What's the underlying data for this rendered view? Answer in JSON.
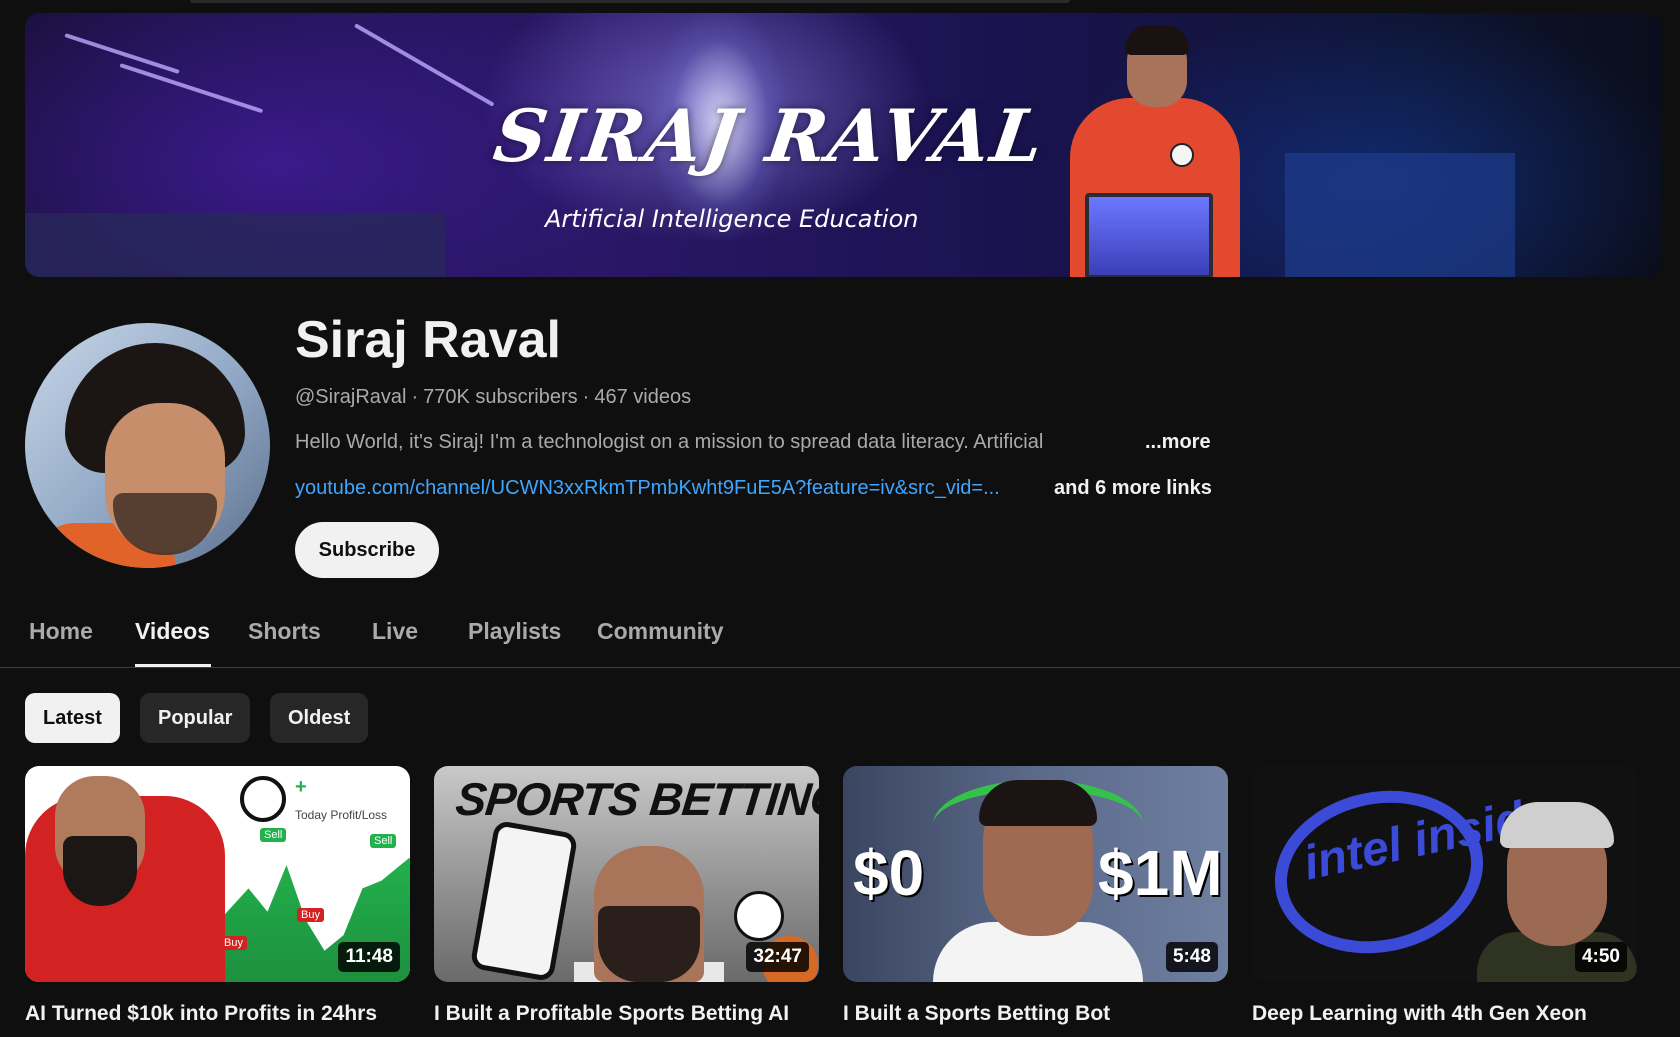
{
  "banner": {
    "title": "SIRAJ RAVAL",
    "subtitle": "Artificial Intelligence Education"
  },
  "channel": {
    "name": "Siraj Raval",
    "handle": "@SirajRaval",
    "subscribers": "770K subscribers",
    "videos": "467 videos",
    "description": "Hello World, it's Siraj!  I'm a technologist on a mission to spread data literacy. Artificial",
    "more_label": "...more",
    "link": "youtube.com/channel/UCWN3xxRkmTPmbKwht9FuE5A?feature=iv&src_vid=...",
    "more_links": "and 6 more links",
    "subscribe_label": "Subscribe"
  },
  "tabs": [
    {
      "label": "Home",
      "active": false
    },
    {
      "label": "Videos",
      "active": true
    },
    {
      "label": "Shorts",
      "active": false
    },
    {
      "label": "Live",
      "active": false
    },
    {
      "label": "Playlists",
      "active": false
    },
    {
      "label": "Community",
      "active": false
    }
  ],
  "filters": [
    {
      "label": "Latest",
      "selected": true
    },
    {
      "label": "Popular",
      "selected": false
    },
    {
      "label": "Oldest",
      "selected": false
    }
  ],
  "videos": [
    {
      "title": "AI Turned $10k into Profits in 24hrs",
      "duration": "11:48",
      "thumb_text": {
        "pl": "+",
        "tpl": "Today Profit/Loss",
        "sell": "Sell",
        "buy": "Buy"
      }
    },
    {
      "title": "I Built a Profitable Sports Betting AI",
      "duration": "32:47",
      "thumb_text": {
        "heading": "SPORTS BETTING"
      }
    },
    {
      "title": "I Built a Sports Betting Bot",
      "duration": "5:48",
      "thumb_text": {
        "left": "$0",
        "right": "$1M"
      }
    },
    {
      "title": "Deep Learning with 4th Gen Xeon",
      "duration": "4:50",
      "thumb_text": {
        "logo": "intel inside"
      }
    }
  ],
  "colors": {
    "background": "#0f0f0f",
    "link": "#3ea6ff",
    "text_primary": "#f1f1f1",
    "text_secondary": "#aaaaaa"
  }
}
